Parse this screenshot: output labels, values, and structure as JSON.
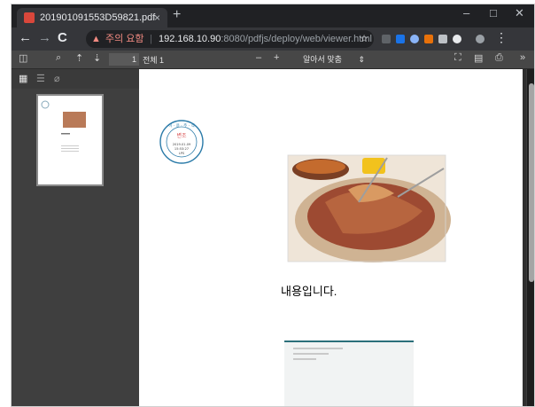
{
  "browser": {
    "tab_title": "201901091553D59821.pdf",
    "tab_close": "×",
    "new_tab": "+",
    "win_minimize": "–",
    "win_maximize": "□",
    "win_close": "✕",
    "nav_back": "←",
    "nav_forward": "→",
    "nav_reload": "C",
    "security_label": "주의 요함",
    "url_host": "192.168.10.90",
    "url_path": ":8080/pdfjs/deploy/web/viewer.html",
    "star": "☆",
    "menu": "⋮"
  },
  "pdf_toolbar": {
    "page_number": "1",
    "page_count": "전체 1",
    "zoom_out": "–",
    "zoom_in": "+",
    "zoom_value": "알아서 맞춤",
    "zoom_arrow": "⇕",
    "more": "»"
  },
  "document": {
    "body_text": "내용입니다.",
    "stamp_lines": [
      "이 · 용 · 주 · 식",
      "변조",
      "2019.01.09",
      "15:53:27",
      "LPS"
    ]
  }
}
